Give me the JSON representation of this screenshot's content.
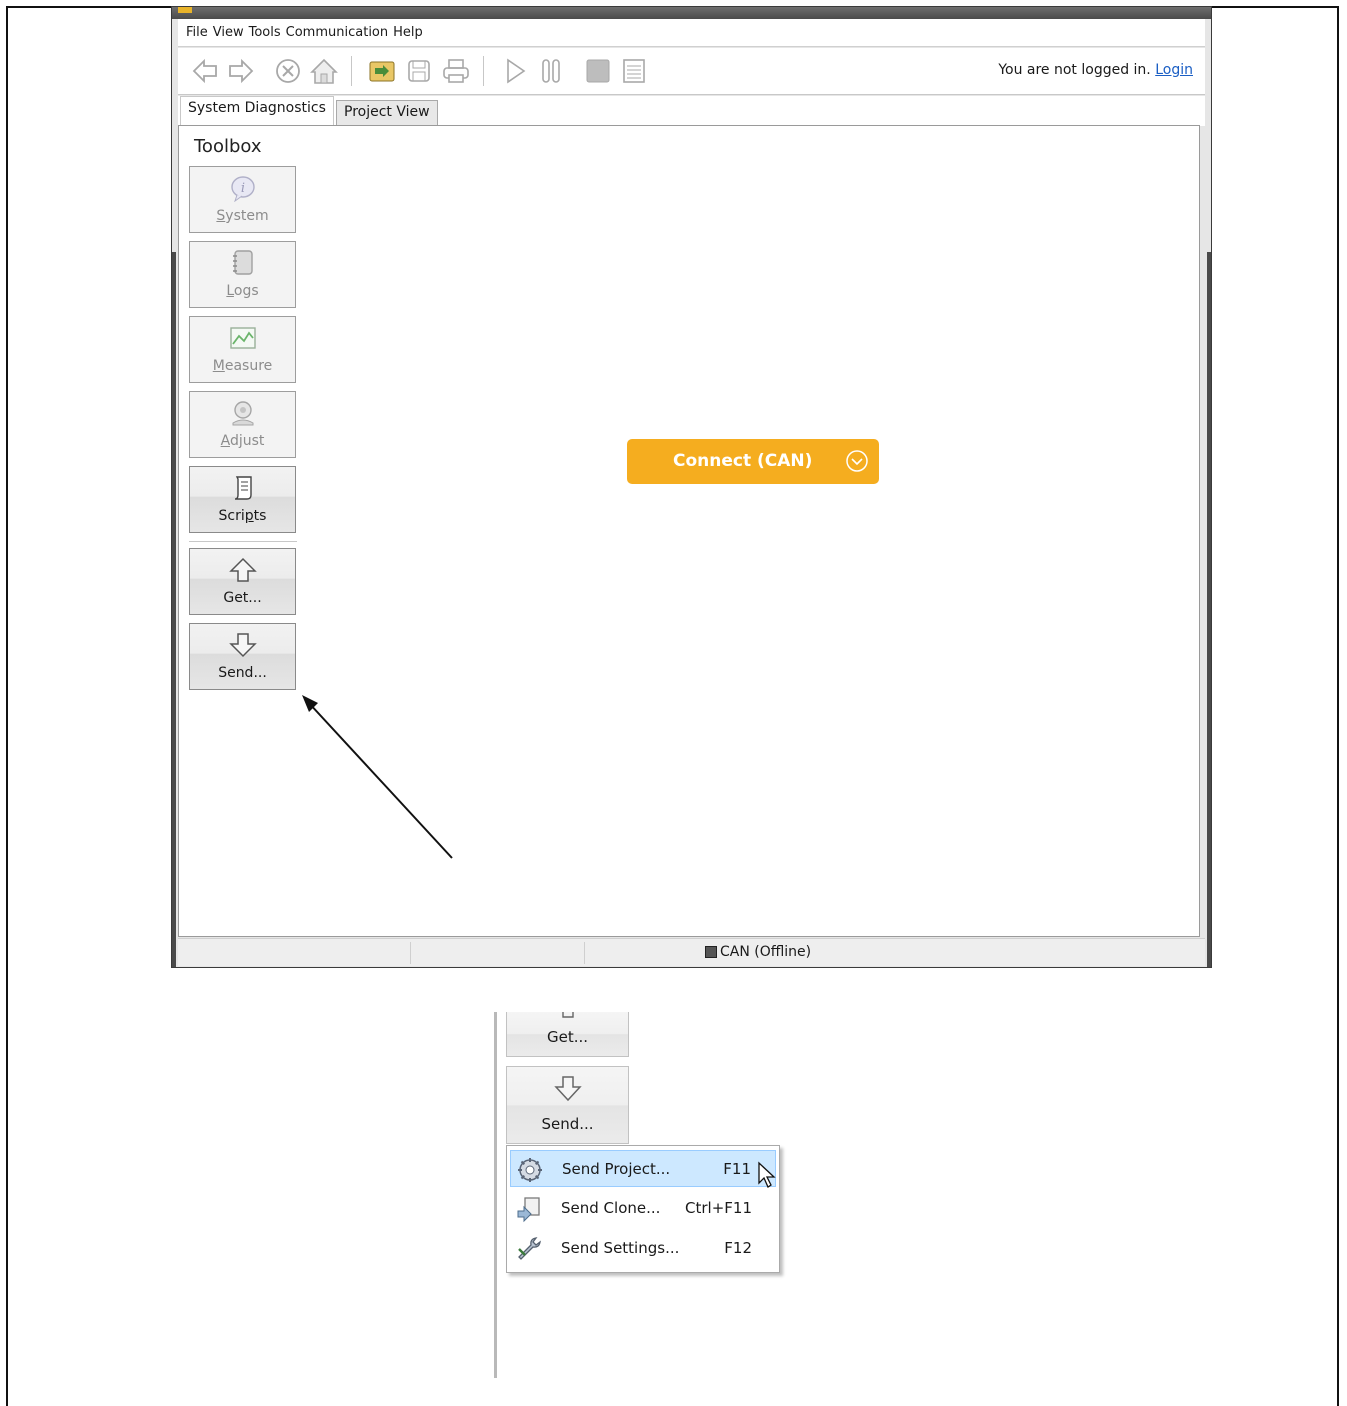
{
  "menu": [
    "File",
    "View",
    "Tools",
    "Communication",
    "Help"
  ],
  "toolbar": {
    "buttons": [
      "back-icon",
      "forward-icon",
      "stop-icon",
      "home-icon",
      "open-icon",
      "save-icon",
      "print-icon",
      "play-icon",
      "pause-icon",
      "stop-square-icon",
      "list-icon"
    ],
    "login_prompt": "You are not logged in.",
    "login_link": "Login"
  },
  "tabs": [
    "System Diagnostics",
    "Project View"
  ],
  "toolbox": {
    "title": "Toolbox",
    "buttons": [
      {
        "pre": "",
        "u": "S",
        "post": "ystem",
        "icon": "info-icon",
        "enabled": false
      },
      {
        "pre": "",
        "u": "L",
        "post": "ogs",
        "icon": "logbook-icon",
        "enabled": false
      },
      {
        "pre": "",
        "u": "M",
        "post": "easure",
        "icon": "chart-icon",
        "enabled": false
      },
      {
        "pre": "",
        "u": "A",
        "post": "djust",
        "icon": "gauge-icon",
        "enabled": false
      },
      {
        "pre": "Scri",
        "u": "p",
        "post": "ts",
        "icon": "script-icon",
        "enabled": true
      },
      {
        "pre": "Get...",
        "u": "",
        "post": "",
        "icon": "up-arrow-icon",
        "enabled": true
      },
      {
        "pre": "Send...",
        "u": "",
        "post": "",
        "icon": "down-arrow-icon",
        "enabled": true
      }
    ]
  },
  "connect": {
    "label": "Connect (CAN)",
    "color": "#f5ad1f"
  },
  "statusbar": {
    "connection": "CAN (Offline)"
  },
  "inset": {
    "get_label": "Get...",
    "send_label": "Send...",
    "menu_items": [
      {
        "label": "Send Project...",
        "shortcut": "F11",
        "icon": "project-gear-icon",
        "highlighted": true
      },
      {
        "label": "Send Clone...",
        "shortcut": "Ctrl+F11",
        "icon": "clone-icon",
        "highlighted": false
      },
      {
        "label": "Send Settings...",
        "shortcut": "F12",
        "icon": "settings-wrench-icon",
        "highlighted": false
      }
    ]
  }
}
